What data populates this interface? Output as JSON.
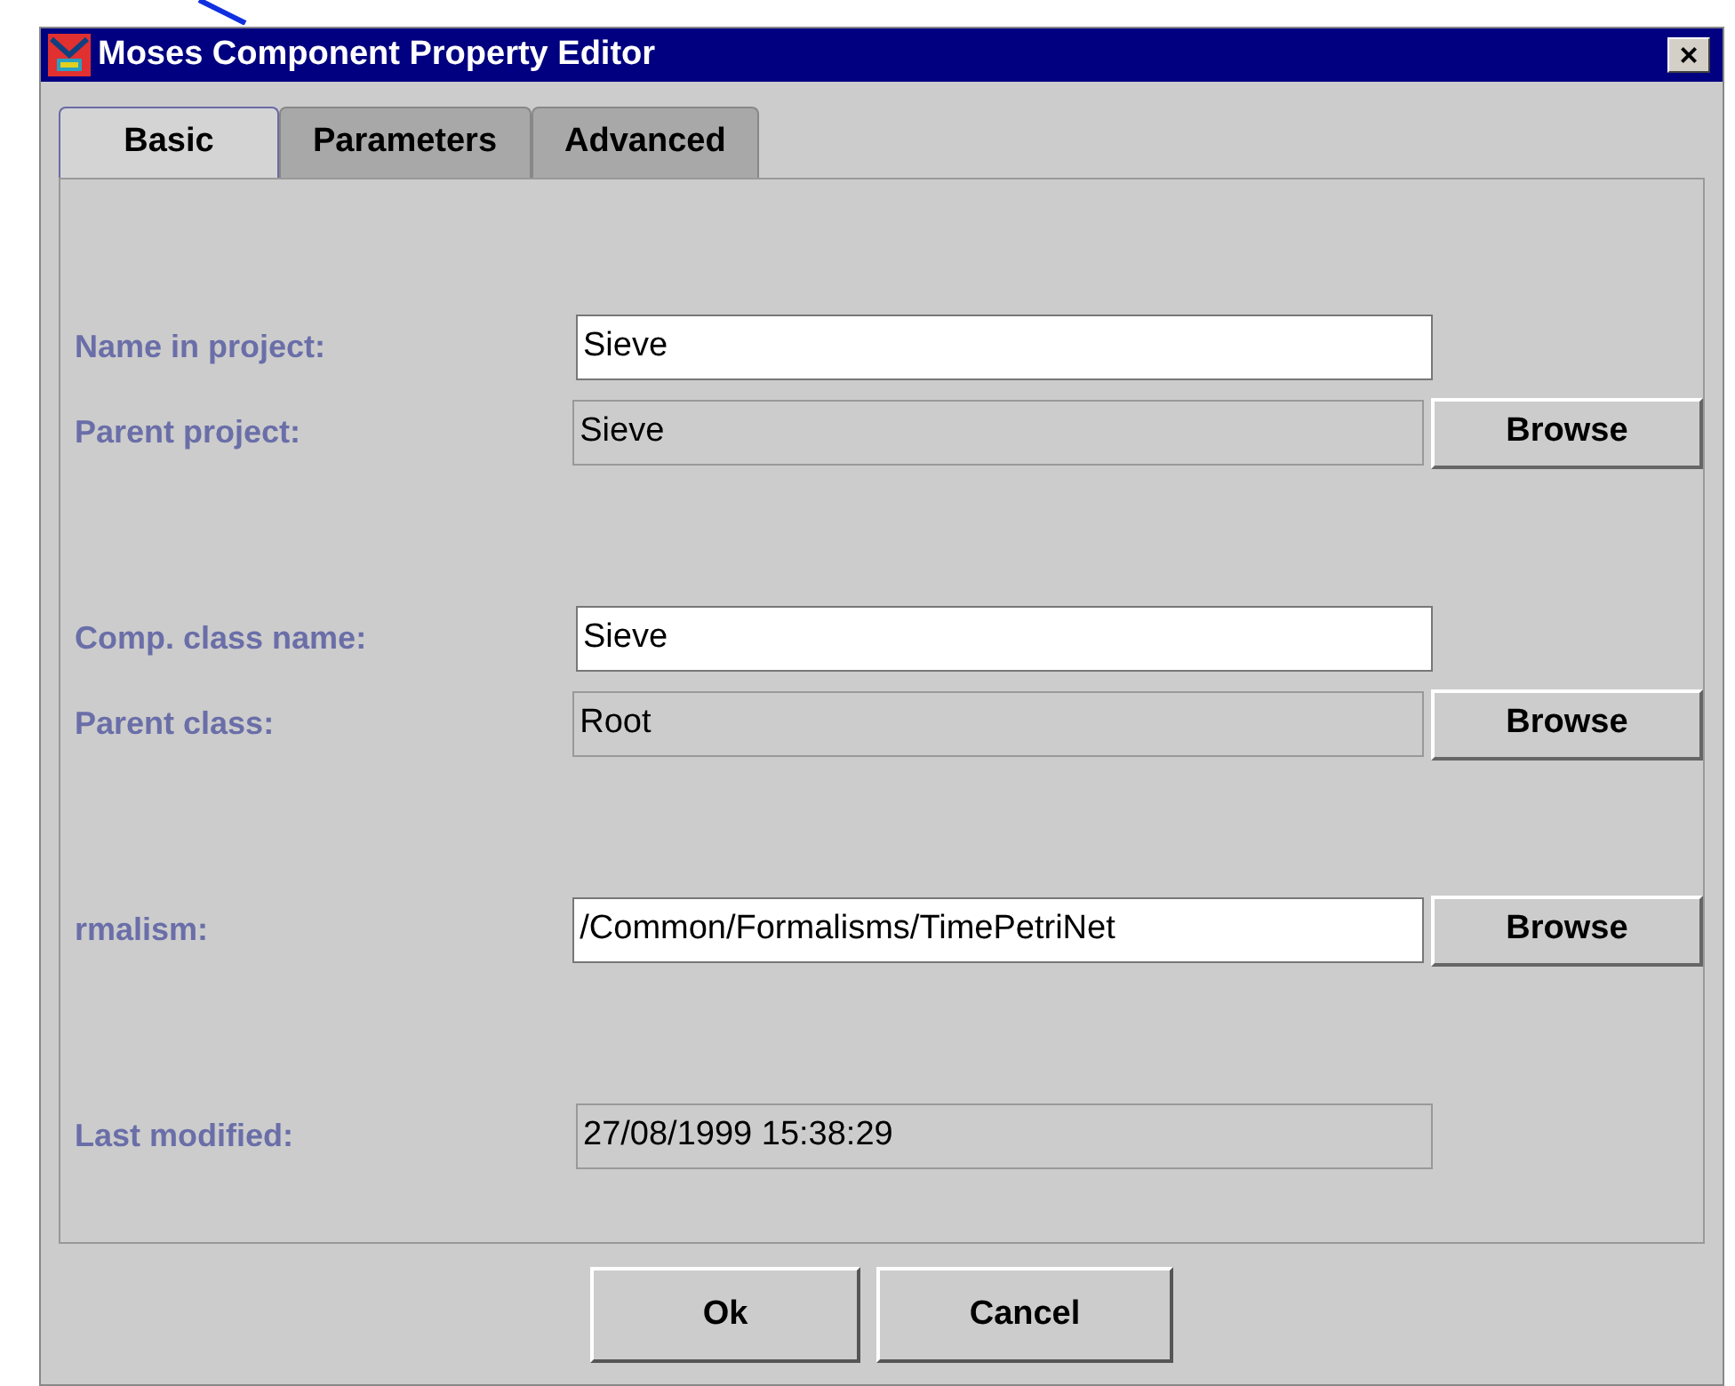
{
  "window": {
    "title": "Moses Component Property Editor",
    "close": "×"
  },
  "tabs": [
    {
      "label": "Basic",
      "selected": true
    },
    {
      "label": "Parameters",
      "selected": false
    },
    {
      "label": "Advanced",
      "selected": false
    }
  ],
  "groups": [
    [
      {
        "label": "Name in project:",
        "value": "Sieve",
        "editable": true
      },
      {
        "label": "Parent project:",
        "value": "Sieve",
        "editable": false,
        "browse": "Browse"
      }
    ],
    [
      {
        "label": "Comp. class name:",
        "value": "Sieve",
        "editable": true
      },
      {
        "label": "Parent class:",
        "value": "Root",
        "editable": false,
        "browse": "Browse"
      }
    ],
    [
      {
        "label": "rmalism:",
        "value": "/Common/Formalisms/TimePetriNet",
        "editable": true,
        "browse": "Browse"
      }
    ],
    [
      {
        "label": "Last modified:",
        "value": "27/08/1999 15:38:29",
        "editable": false
      }
    ]
  ],
  "buttons": [
    "Ok",
    "Cancel"
  ]
}
